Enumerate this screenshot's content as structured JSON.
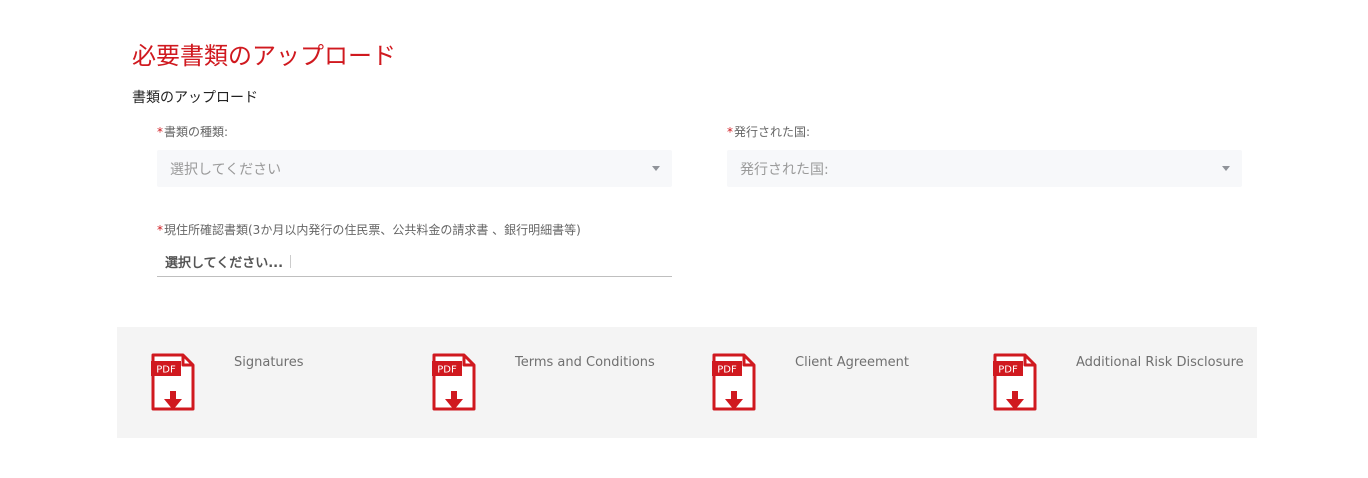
{
  "page": {
    "title": "必要書類のアップロード",
    "section_title": "書類のアップロード"
  },
  "form": {
    "required_mark": "*",
    "document_type": {
      "label": "書類の種類:",
      "placeholder": "選択してください"
    },
    "issuing_country": {
      "label": "発行された国:",
      "placeholder": "発行された国:"
    },
    "address_proof": {
      "label": "現住所確認書類(3か月以内発行の住民票、公共料金の請求書 、銀行明細書等)",
      "placeholder": "選択してください..."
    }
  },
  "documents": {
    "icon_text": "PDF",
    "items": [
      {
        "label": "Signatures",
        "icon": "pdf-download-icon"
      },
      {
        "label": "Terms and Conditions",
        "icon": "pdf-download-icon"
      },
      {
        "label": "Client Agreement",
        "icon": "pdf-download-icon"
      },
      {
        "label": "Additional Risk Disclosure",
        "icon": "pdf-download-icon"
      }
    ]
  },
  "colors": {
    "accent": "#d0191f",
    "panel_background": "#f4f4f4",
    "select_background": "#f7f8fa"
  }
}
